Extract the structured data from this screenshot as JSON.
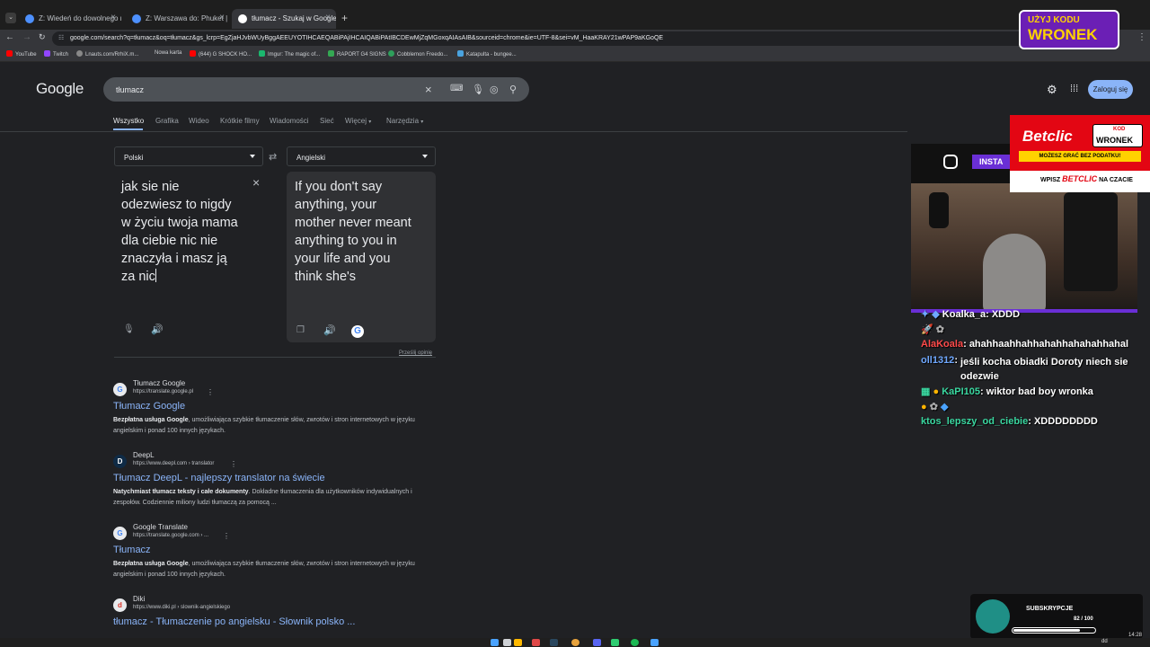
{
  "tabs": [
    {
      "title": "Z: Wiedeń do dowolnego miej..."
    },
    {
      "title": "Z: Warszawa do: Phuket | Loty ..."
    },
    {
      "title": "tłumacz - Szukaj w Google"
    }
  ],
  "url": "google.com/search?q=tłumacz&oq=tłumacz&gs_lcrp=EgZjaHJvbWUyBggAEEUYOTIHCAEQABiPAjIHCAIQABiPAtIBCDEwMjZqMGoxqAIAsAIB&sourceid=chrome&ie=UTF-8&sei=vM_HaaKRAY21wPAP9aKGoQE",
  "bookmarks": [
    "YouTube",
    "Twitch",
    "Lnauts.com/RrhiX.m...",
    "Nowa karta",
    "(644) G SHOCK HO...",
    "Imgur: The magic of...",
    "RAPORT G4 SIGNS",
    "Cobblemon Freedo...",
    "Katapulta - bungee..."
  ],
  "google": {
    "logo": "Google",
    "query": "tłumacz",
    "login": "Zaloguj się",
    "nav": [
      "Wszystko",
      "Grafika",
      "Wideo",
      "Krótkie filmy",
      "Wiadomości",
      "Sieć",
      "Więcej",
      "Narzędzia"
    ]
  },
  "translator": {
    "source_lang": "Polski",
    "target_lang": "Angielski",
    "source_lines": [
      "jak sie nie",
      "odezwiesz to nigdy",
      "w życiu twoja mama",
      "dla ciebie nic nie",
      "znaczyła i masz ją",
      "za nic"
    ],
    "target_lines": [
      "If you don't say",
      "anything, your",
      "mother never meant",
      "anything to you in",
      "your life and you",
      "think she's"
    ],
    "feedback": "Prześlij opinię"
  },
  "results": [
    {
      "fav": "G",
      "site": "Tłumacz Google",
      "url": "https://translate.google.pl",
      "title": "Tłumacz Google",
      "bold": "Bezpłatna usługa Google",
      "snippet": ", umożliwiająca szybkie tłumaczenie słów, zwrotów i stron internetowych w języku angielskim i ponad 100 innych językach."
    },
    {
      "fav": "D",
      "site": "DeepL",
      "url": "https://www.deepl.com › translator",
      "title": "Tłumacz DeepL - najlepszy translator na świecie",
      "bold": "Natychmiast tłumacz teksty i całe dokumenty",
      "snippet": ". Dokładne tłumaczenia dla użytkowników indywidualnych i zespołów. Codziennie miliony ludzi tłumaczą za pomocą ..."
    },
    {
      "fav": "G",
      "site": "Google Translate",
      "url": "https://translate.google.com › ...",
      "title": "Tłumacz",
      "bold": "Bezpłatna usługa Google",
      "snippet": ", umożliwiająca szybkie tłumaczenie słów, zwrotów i stron internetowych w języku angielskim i ponad 100 innych językach."
    },
    {
      "fav": "d",
      "site": "Diki",
      "url": "https://www.diki.pl › slownik-angielskiego",
      "title": "tłumacz - Tłumaczenie po angielsku - Słownik polsko ...",
      "bold": "",
      "snippet": ""
    }
  ],
  "overlay": {
    "promo_line1": "UŻYJ KODU",
    "promo_line2": "WRONEK",
    "betclic_brand": "Betclic",
    "betclic_code_label": "KOD",
    "betclic_code": "WRONEK",
    "betclic_tagline": "MOŻESZ GRAĆ BEZ PODATKU!",
    "betclic_wpisz": "WPISZ",
    "betclic_code2": "BETCLIC",
    "betclic_tail": "NA CZACIE",
    "insta": "INSTA",
    "chat": [
      {
        "user": "Koalka_a",
        "msg": "XDDD",
        "color": "#ffffff"
      },
      {
        "user": "AlaKoala",
        "msg": "ahahhaahhahhahahhahahahhahal",
        "color": "#ff4a4a"
      },
      {
        "user": "oll1312",
        "msg": "jeśli kocha obiadki Doroty niech sie odezwie",
        "color": "#6fa8ff"
      },
      {
        "user": "KaPI105",
        "msg": "wiktor bad boy wronka",
        "color": "#3ad7a0"
      },
      {
        "user": "ktos_lepszy_od_ciebie",
        "msg": "XDDDDDDDD",
        "color": "#3ad7a0"
      }
    ],
    "subs_label": "SUBSKRYPCJE",
    "subs_count": "82 / 100",
    "subs_progress": 0.82,
    "clock": "14:28",
    "day": "dd"
  }
}
